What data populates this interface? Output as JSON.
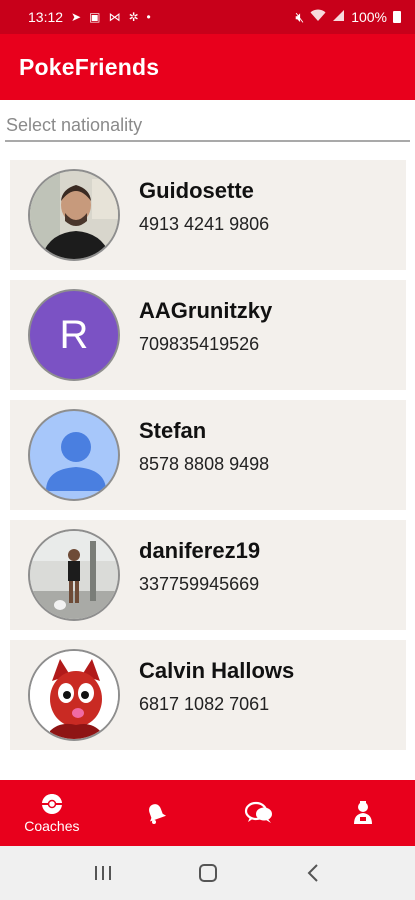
{
  "status_bar": {
    "time": "13:12",
    "battery": "100%"
  },
  "app": {
    "title": "PokeFriends"
  },
  "filter": {
    "placeholder": "Select nationality"
  },
  "coaches": [
    {
      "name": "Guidosette",
      "phone": "4913 4241 9806",
      "avatar": "photo"
    },
    {
      "name": "AAGrunitzky",
      "phone": "709835419526",
      "avatar": "letter",
      "initial": "R"
    },
    {
      "name": "Stefan",
      "phone": "8578 8808 9498",
      "avatar": "default-person"
    },
    {
      "name": "daniferez19",
      "phone": "337759945669",
      "avatar": "photo"
    },
    {
      "name": "Calvin Hallows",
      "phone": "6817 1082 7061",
      "avatar": "illustration"
    }
  ],
  "bottom_nav": {
    "items": [
      {
        "icon": "pokeball-icon",
        "label": "Coaches"
      },
      {
        "icon": "bell-icon",
        "label": ""
      },
      {
        "icon": "chat-bubbles-icon",
        "label": ""
      },
      {
        "icon": "profile-badge-icon",
        "label": ""
      }
    ]
  },
  "colors": {
    "status_bar": "#c8001a",
    "primary": "#e8001c",
    "card_bg": "#f3f0ec",
    "avatar_letter_bg": "#7b52c4",
    "avatar_default_bg": "#a7c7fa",
    "avatar_default_figure": "#4a7fe0"
  }
}
